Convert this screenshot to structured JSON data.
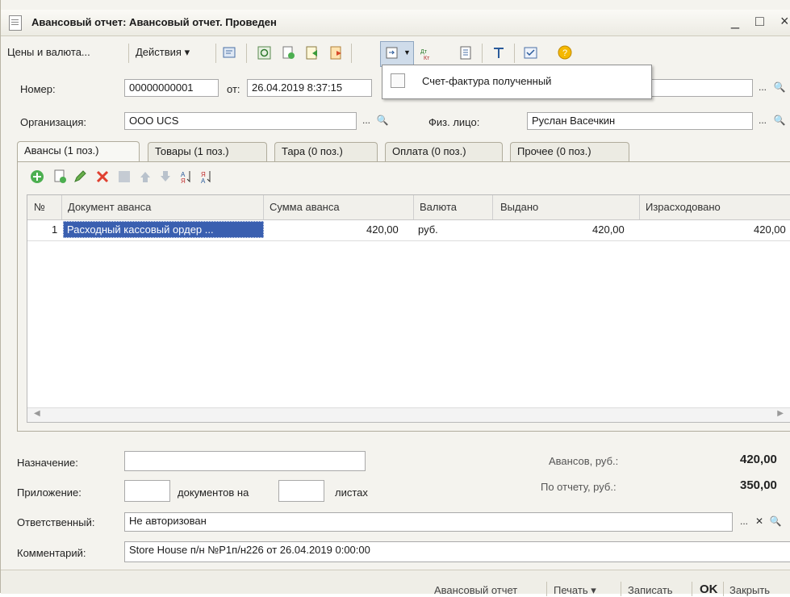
{
  "window": {
    "title": "Авансовый отчет: Авансовый отчет. Проведен",
    "minimize": "_",
    "maximize": "□",
    "close": "×"
  },
  "toolbar": {
    "prices_label": "Цены и валюта...",
    "actions_label": "Действия ▾"
  },
  "dropdown": {
    "item_label": "Счет-фактура полученный"
  },
  "form": {
    "number_label": "Номер:",
    "number_value": "00000000001",
    "date_label": "от:",
    "date_value": "26.04.2019 8:37:15",
    "org_label": "Организация:",
    "org_value": "ООО UCS",
    "person_label": "Физ. лицо:",
    "person_value": "Руслан Васечкин"
  },
  "tabs": [
    "Авансы (1 поз.)",
    "Товары (1 поз.)",
    "Тара (0 поз.)",
    "Оплата (0 поз.)",
    "Прочее (0 поз.)"
  ],
  "table": {
    "headers": [
      "№",
      "Документ аванса",
      "Сумма аванса",
      "Валюта",
      "Выдано",
      "Израсходовано"
    ],
    "rows": [
      [
        "1",
        "Расходный кассовый ордер ...",
        "420,00",
        "руб.",
        "420,00",
        "420,00"
      ]
    ]
  },
  "bottom": {
    "purpose_label": "Назначение:",
    "attachment_label": "Приложение:",
    "docs_on_label": "документов на",
    "sheets_label": "листах",
    "advances_label": "Авансов, руб.:",
    "advances_value": "420,00",
    "report_label": "По отчету, руб.:",
    "report_value": "350,00",
    "responsible_label": "Ответственный:",
    "responsible_value": "Не авторизован",
    "comment_label": "Комментарий:",
    "comment_value": "Store House п/н №Р1п/н226 от 26.04.2019 0:00:00"
  },
  "footer": {
    "report_btn": "Авансовый отчет",
    "print_btn": "Печать ▾",
    "save_btn": "Записать",
    "ok_btn": "OK",
    "close_btn": "Закрыть"
  }
}
